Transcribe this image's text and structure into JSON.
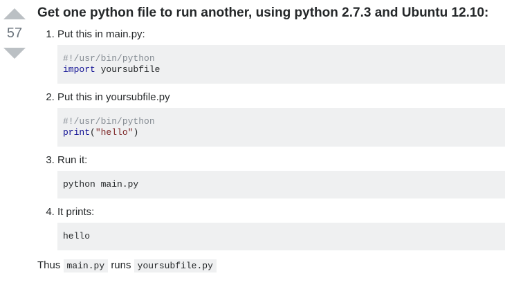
{
  "vote": {
    "count": "57"
  },
  "answer": {
    "title": "Get one python file to run another, using python 2.7.3 and Ubuntu 12.10:",
    "steps": [
      {
        "text": "Put this in main.py:",
        "line1": "#!/usr/bin/python",
        "kw": "import",
        "rest": " yoursubfile"
      },
      {
        "text": "Put this in yoursubfile.py",
        "line1": "#!/usr/bin/python",
        "kw": "print",
        "open": "(",
        "str": "\"hello\"",
        "close": ")"
      },
      {
        "text": "Run it:",
        "code": "python main.py"
      },
      {
        "text": "It prints:",
        "code": "hello"
      }
    ],
    "conclusion": {
      "thus": "Thus",
      "code1": "main.py",
      "runs": "runs",
      "code2": "yoursubfile.py"
    }
  },
  "colors": {
    "code_bg": "#eff0f1",
    "comment": "#858c93",
    "keyword": "#101094",
    "string": "#7d2727",
    "arrow": "#bbc0c4"
  }
}
